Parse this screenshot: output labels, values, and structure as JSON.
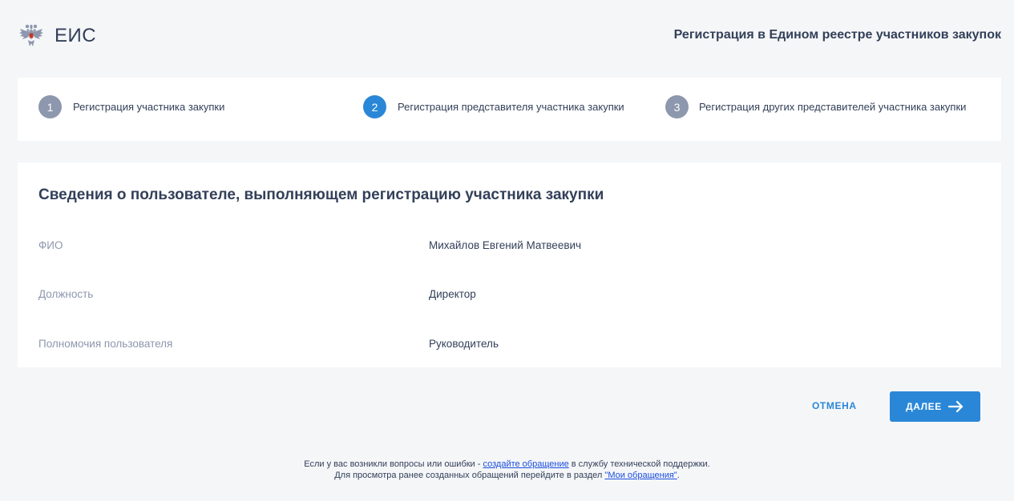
{
  "header": {
    "logo_text": "ЕИС",
    "title": "Регистрация в Едином реестре участников закупок"
  },
  "steps": [
    {
      "number": "1",
      "label": "Регистрация участника закупки",
      "state": "done"
    },
    {
      "number": "2",
      "label": "Регистрация представителя участника закупки",
      "state": "active"
    },
    {
      "number": "3",
      "label": "Регистрация других представителей участника закупки",
      "state": "done"
    }
  ],
  "card": {
    "title": "Сведения о пользователе, выполняющем регистрацию участника закупки",
    "fields": [
      {
        "label": "ФИО",
        "value": "Михайлов Евгений Матвеевич"
      },
      {
        "label": "Должность",
        "value": "Директор"
      },
      {
        "label": "Полномочия пользователя",
        "value": "Руководитель"
      }
    ]
  },
  "actions": {
    "cancel_label": "ОТМЕНА",
    "next_label": "ДАЛЕЕ"
  },
  "footer": {
    "line1_before": "Если у вас возникли вопросы или ошибки - ",
    "line1_link": "создайте обращение",
    "line1_after": " в службу технической поддержки.",
    "line2_before": "Для просмотра ранее созданных обращений перейдите в раздел ",
    "line2_link": "\"Мои обращения\"",
    "line2_after": "."
  },
  "colors": {
    "accent": "#2a87d7",
    "step_done": "#8d97ad",
    "text": "#334059",
    "muted": "#8d97ad",
    "background": "#f5f6f8",
    "link": "#1a4ee0"
  },
  "icons": {
    "logo": "eagle-emblem-icon",
    "next": "arrow-right-icon"
  }
}
